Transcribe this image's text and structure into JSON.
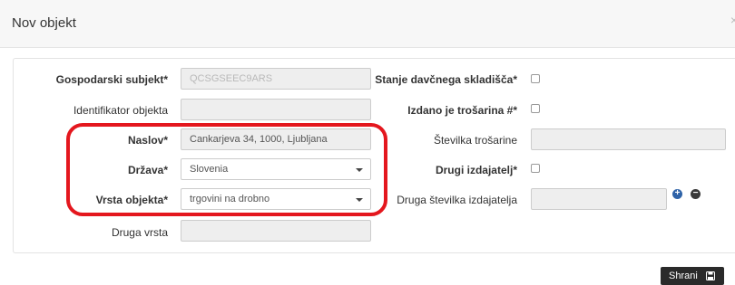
{
  "modal": {
    "title": "Nov objekt",
    "close_glyph": "×"
  },
  "form": {
    "left": {
      "gospodarski_subjekt": {
        "label": "Gospodarski subjekt*",
        "placeholder": "QCSGSEEC9ARS"
      },
      "identifikator_objekta": {
        "label": "Identifikator objekta",
        "value": ""
      },
      "naslov": {
        "label": "Naslov*",
        "value": "Cankarjeva 34, 1000, Ljubljana"
      },
      "drzava": {
        "label": "Država*",
        "value": "Slovenia"
      },
      "vrsta_objekta": {
        "label": "Vrsta objekta*",
        "value": "trgovini na drobno"
      },
      "druga_vrsta": {
        "label": "Druga vrsta",
        "value": ""
      }
    },
    "right": {
      "stanje_davcnega_skladisca": {
        "label": "Stanje davčnega skladišča*",
        "checked": false
      },
      "izdano_je_trosarina": {
        "label": "Izdano je trošarina #*",
        "checked": false
      },
      "stevilka_trosarine": {
        "label": "Številka trošarine",
        "value": ""
      },
      "drugi_izdajatelj": {
        "label": "Drugi izdajatelj*",
        "checked": false
      },
      "druga_stevilka_izdajatelja": {
        "label": "Druga številka izdajatelja",
        "value": ""
      }
    }
  },
  "icons": {
    "add": "plus-circle-icon",
    "remove": "minus-circle-icon",
    "save": "floppy-disk-icon",
    "dropdown": "caret-down-icon"
  },
  "highlight": {
    "color": "#e4171e"
  },
  "footer": {
    "save_label": "Shrani"
  }
}
